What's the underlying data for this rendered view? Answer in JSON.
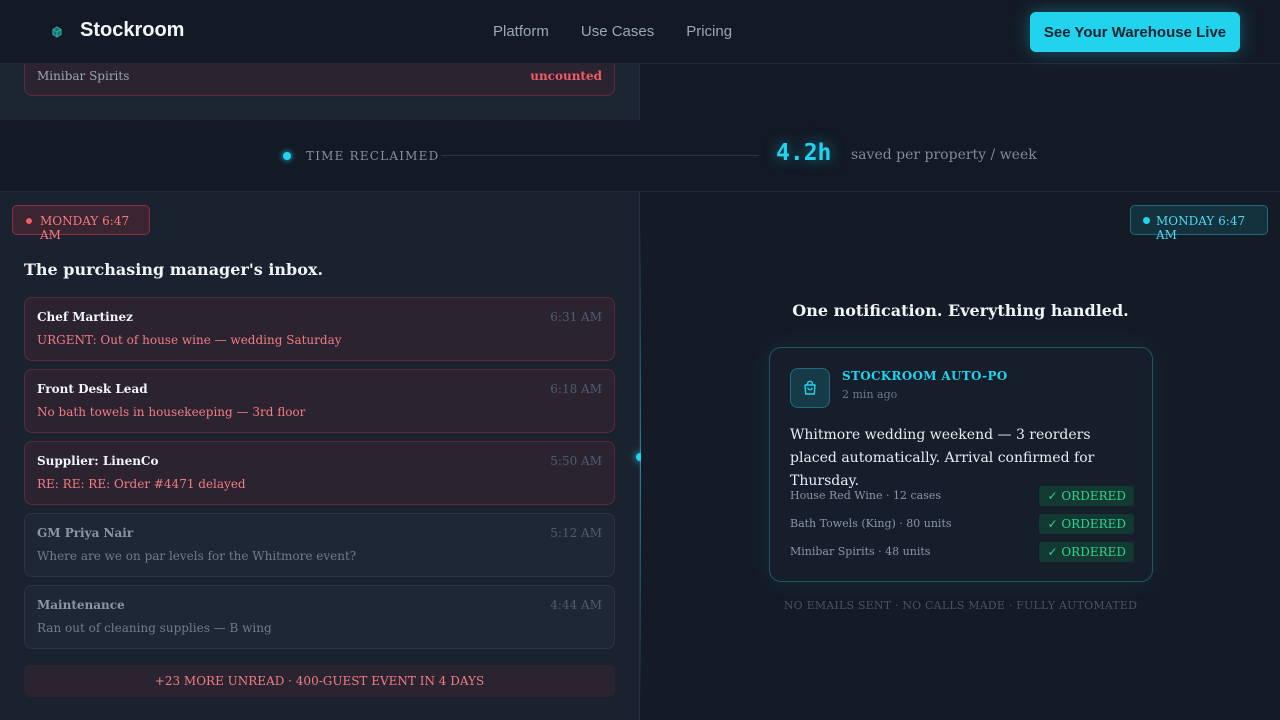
{
  "nav": {
    "brand": "Stockroom",
    "links": [
      "Platform",
      "Use Cases",
      "Pricing"
    ],
    "cta": "See Your Warehouse Live"
  },
  "remnant": {
    "label": "Minibar Spirits",
    "status": "uncounted"
  },
  "metric": {
    "label": "TIME RECLAIMED",
    "value": "4.2h",
    "description": "saved per property / week"
  },
  "left": {
    "badge": "MONDAY 6:47 AM",
    "title": "The purchasing manager's inbox.",
    "emails": [
      {
        "from": "Chef Martinez",
        "time": "6:31 AM",
        "subject": "URGENT: Out of house wine — wedding Saturday"
      },
      {
        "from": "Front Desk Lead",
        "time": "6:18 AM",
        "subject": "No bath towels in housekeeping — 3rd floor"
      },
      {
        "from": "Supplier: LinenCo",
        "time": "5:50 AM",
        "subject": "RE: RE: RE: Order #4471 delayed"
      },
      {
        "from": "GM Priya Nair",
        "time": "5:12 AM",
        "subject": "Where are we on par levels for the Whitmore event?"
      },
      {
        "from": "Maintenance",
        "time": "4:44 AM",
        "subject": "Ran out of cleaning supplies — B wing"
      }
    ],
    "more": "+23 MORE UNREAD · 400-GUEST EVENT IN 4 DAYS"
  },
  "right": {
    "badge": "MONDAY 6:47 AM",
    "title": "One notification. Everything handled.",
    "card": {
      "source": "STOCKROOM AUTO-PO",
      "ago": "2 min ago",
      "message": "Whitmore wedding weekend — 3 reorders placed automatically. Arrival confirmed for Thursday.",
      "items": [
        {
          "name": "House Red Wine · 12 cases",
          "status": "✓ ORDERED"
        },
        {
          "name": "Bath Towels (King) · 80 units",
          "status": "✓ ORDERED"
        },
        {
          "name": "Minibar Spirits · 48 units",
          "status": "✓ ORDERED"
        }
      ]
    },
    "footnote": "NO EMAILS SENT · NO CALLS MADE · FULLY AUTOMATED"
  },
  "colors": {
    "accent": "#22d3ee",
    "alert": "#f05b66",
    "success": "#2fd48e",
    "background": "#141b26"
  },
  "icons": {
    "brand": "cube-icon",
    "card": "shopping-bag-icon"
  }
}
